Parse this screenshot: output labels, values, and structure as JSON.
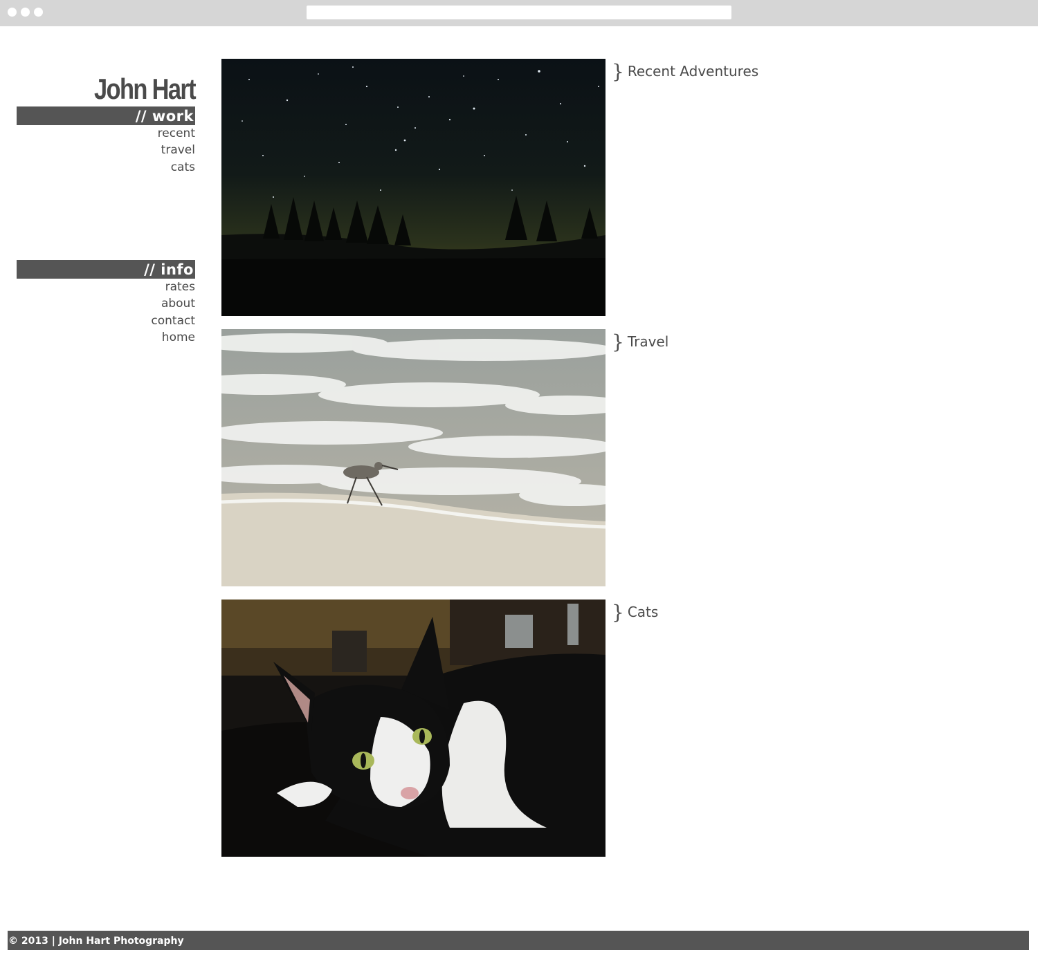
{
  "site": {
    "title": "John Hart"
  },
  "nav": {
    "work_header": "// work",
    "work_items": [
      "recent",
      "travel",
      "cats"
    ],
    "info_header": "// info",
    "info_items": [
      "rates",
      "about",
      "contact",
      "home"
    ]
  },
  "gallery": [
    {
      "caption": "Recent Adventures",
      "photo": "night-sky-trees-photo"
    },
    {
      "caption": "Travel",
      "photo": "sandpiper-beach-photo"
    },
    {
      "caption": "Cats",
      "photo": "tuxedo-cat-photo"
    }
  ],
  "footer": {
    "text": "© 2013 | John Hart Photography"
  },
  "colors": {
    "bar": "#555555",
    "text": "#4a4a4a",
    "chrome": "#d6d6d6"
  }
}
